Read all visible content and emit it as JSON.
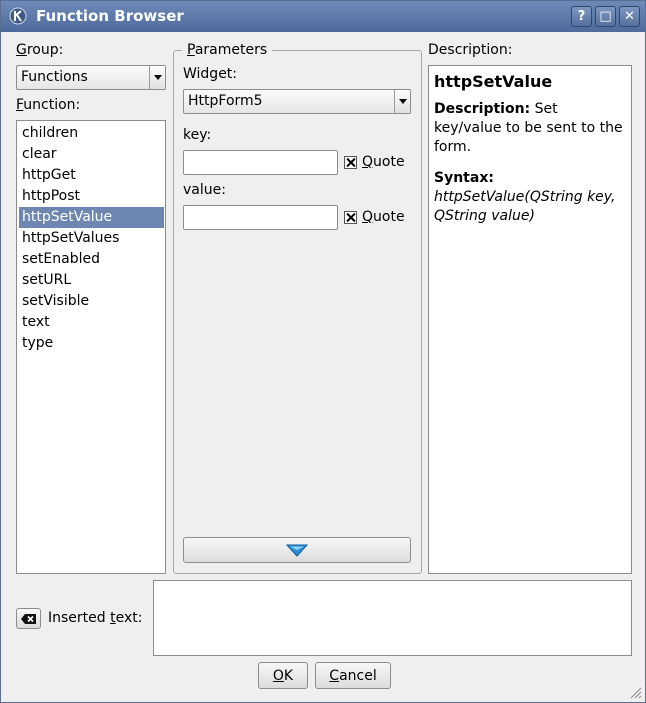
{
  "window": {
    "title": "Function Browser"
  },
  "titlebar": {
    "help": "?",
    "maximize": "□",
    "close": "✕"
  },
  "group": {
    "label_key": "G",
    "label_rest": "roup:",
    "value": "Functions"
  },
  "function": {
    "label_key": "F",
    "label_rest": "unction:",
    "items": [
      "children",
      "clear",
      "httpGet",
      "httpPost",
      "httpSetValue",
      "httpSetValues",
      "setEnabled",
      "setURL",
      "setVisible",
      "text",
      "type"
    ],
    "selected": "httpSetValue"
  },
  "parameters": {
    "title_key": "P",
    "title_rest": "arameters",
    "widget_label": "Widget:",
    "widget_value": "HttpForm5",
    "key_label": "key:",
    "key_value": "",
    "value_label": "value:",
    "value_value": "",
    "quote_key": "Q",
    "quote_rest": "uote"
  },
  "description": {
    "label": "Description:",
    "heading": "httpSetValue",
    "desc_label": "Description:",
    "desc_text": " Set key/value to be sent to the form.",
    "syntax_label": "Syntax:",
    "syntax_text": "httpSetValue(QString key, QString value)"
  },
  "inserted": {
    "label_pre": "Inserted ",
    "label_key": "t",
    "label_post": "ext:",
    "value": ""
  },
  "buttons": {
    "ok_key": "O",
    "ok_rest": "K",
    "cancel_key": "C",
    "cancel_rest": "ancel"
  }
}
